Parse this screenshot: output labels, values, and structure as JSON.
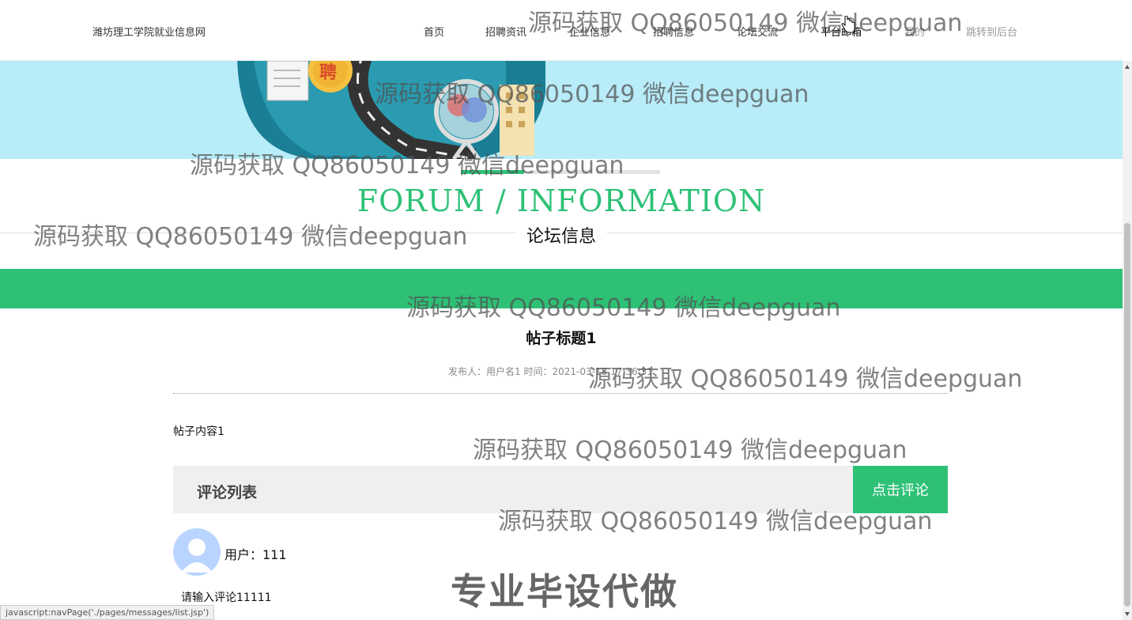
{
  "header": {
    "site_title": "潍坊理工学院就业信息网",
    "nav": [
      {
        "label": "首页"
      },
      {
        "label": "招聘资讯"
      },
      {
        "label": "企业信息"
      },
      {
        "label": "招聘信息"
      },
      {
        "label": "论坛交流"
      },
      {
        "label": "平台邮箱"
      },
      {
        "label": "我的"
      },
      {
        "label": "跳转到后台"
      }
    ]
  },
  "section": {
    "title_en": "FORUM / INFORMATION",
    "title_cn": "论坛信息"
  },
  "post": {
    "title": "帖子标题1",
    "meta": "发布人：用户名1 时间：2021-03-18 17:36:31",
    "content": "帖子内容1"
  },
  "comments": {
    "header": "评论列表",
    "button": "点击评论",
    "items": [
      {
        "user": "用户：111",
        "text": "请输入评论11111"
      }
    ]
  },
  "status_bar": "javascript:navPage('./pages/messages/list.jsp')",
  "watermarks": [
    "源码获取 QQ86050149 微信deepguan",
    "源码获取 QQ86050149 微信deepguan",
    "源码获取 QQ86050149 微信deepguan",
    "源码获取 QQ86050149 微信deepguan",
    "源码获取 QQ86050149 微信deepguan",
    "源码获取 QQ86050149 微信deepguan",
    "源码获取 QQ86050149 微信deepguan",
    "源码获取 QQ86050149 微信deepguan"
  ],
  "promo_text": "专业毕设代做",
  "colors": {
    "accent": "#2ec176",
    "banner_bg": "#b8ecf8",
    "comment_header_bg": "#eeefee"
  },
  "icons": {
    "avatar": "user-avatar-icon",
    "cursor": "hand-pointer-icon"
  }
}
